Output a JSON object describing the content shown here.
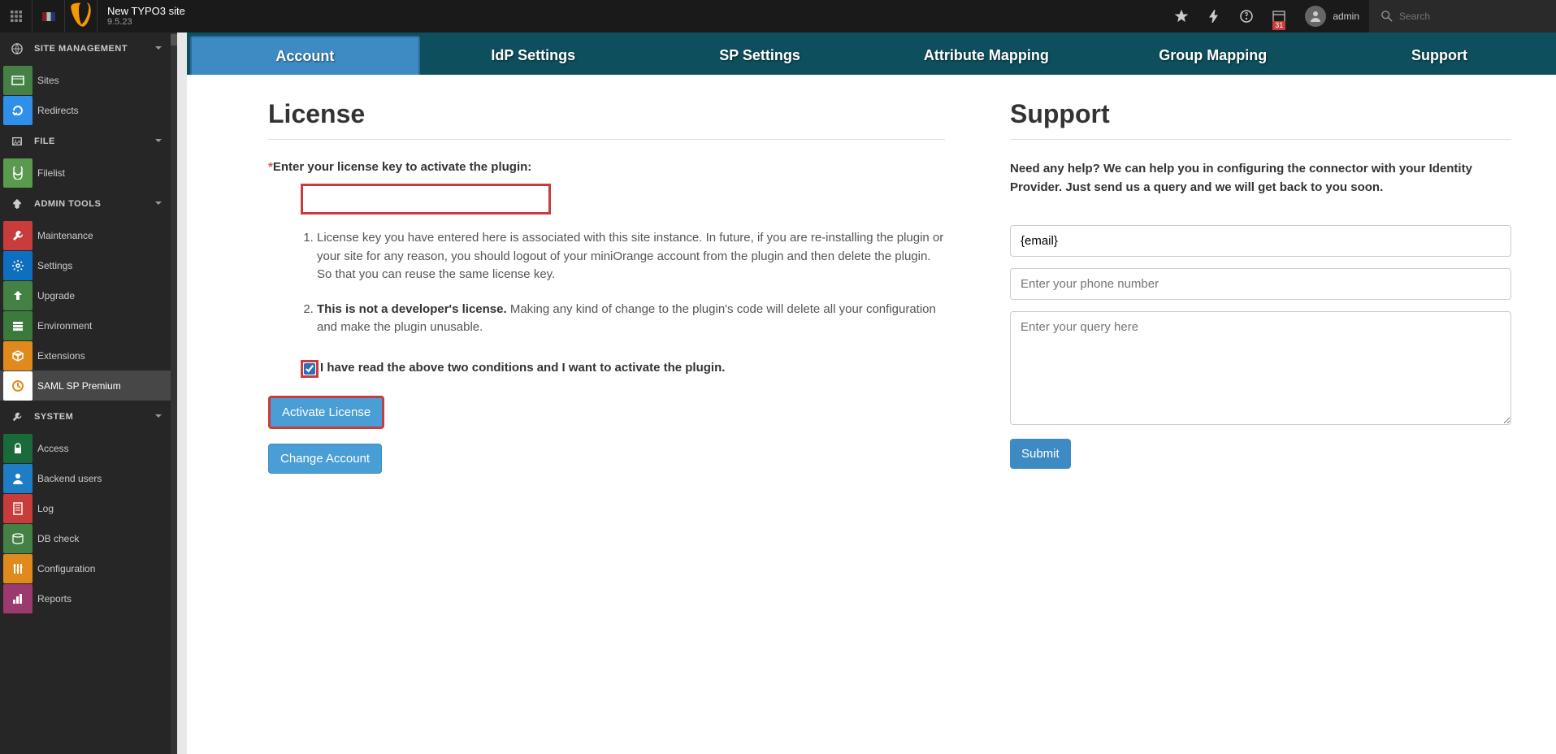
{
  "topbar": {
    "site_name": "New TYPO3 site",
    "version": "9.5.23",
    "username": "admin",
    "calendar_badge": "31",
    "search_placeholder": "Search"
  },
  "module_menu": {
    "groups": [
      {
        "label": "SITE MANAGEMENT",
        "items": [
          {
            "label": "Sites",
            "icon": "ic-sites"
          },
          {
            "label": "Redirects",
            "icon": "ic-redirects"
          }
        ]
      },
      {
        "label": "FILE",
        "items": [
          {
            "label": "Filelist",
            "icon": "ic-filelist"
          }
        ]
      },
      {
        "label": "ADMIN TOOLS",
        "items": [
          {
            "label": "Maintenance",
            "icon": "ic-maintenance"
          },
          {
            "label": "Settings",
            "icon": "ic-settings"
          },
          {
            "label": "Upgrade",
            "icon": "ic-upgrade"
          },
          {
            "label": "Environment",
            "icon": "ic-environment"
          },
          {
            "label": "Extensions",
            "icon": "ic-extensions"
          },
          {
            "label": "SAML SP Premium",
            "icon": "ic-saml",
            "active": true
          }
        ]
      },
      {
        "label": "SYSTEM",
        "items": [
          {
            "label": "Access",
            "icon": "ic-access"
          },
          {
            "label": "Backend users",
            "icon": "ic-beusers"
          },
          {
            "label": "Log",
            "icon": "ic-log"
          },
          {
            "label": "DB check",
            "icon": "ic-dbcheck"
          },
          {
            "label": "Configuration",
            "icon": "ic-config"
          },
          {
            "label": "Reports",
            "icon": "ic-reports"
          }
        ]
      }
    ]
  },
  "tabs": [
    {
      "label": "Account",
      "active": true
    },
    {
      "label": "IdP Settings"
    },
    {
      "label": "SP Settings"
    },
    {
      "label": "Attribute Mapping"
    },
    {
      "label": "Group Mapping"
    },
    {
      "label": "Support"
    }
  ],
  "license": {
    "heading": "License",
    "field_label": "Enter your license key to activate the plugin:",
    "note1": "License key you have entered here is associated with this site instance. In future, if you are re-installing the plugin or your site for any reason, you should logout of your miniOrange account from the plugin and then delete the plugin. So that you can reuse the same license key.",
    "note2_bold": "This is not a developer's license.",
    "note2_rest": " Making any kind of change to the plugin's code will delete all your configuration and make the plugin unusable.",
    "consent": "I have read the above two conditions and I want to activate the plugin.",
    "activate_btn": "Activate License",
    "change_btn": "Change Account"
  },
  "support": {
    "heading": "Support",
    "help_text": "Need any help? We can help you in configuring the connector with your Identity Provider. Just send us a query and we will get back to you soon.",
    "email_placeholder": "",
    "email_value": "{email}",
    "phone_placeholder": "Enter your phone number",
    "query_placeholder": "Enter your query here",
    "submit_btn": "Submit"
  }
}
